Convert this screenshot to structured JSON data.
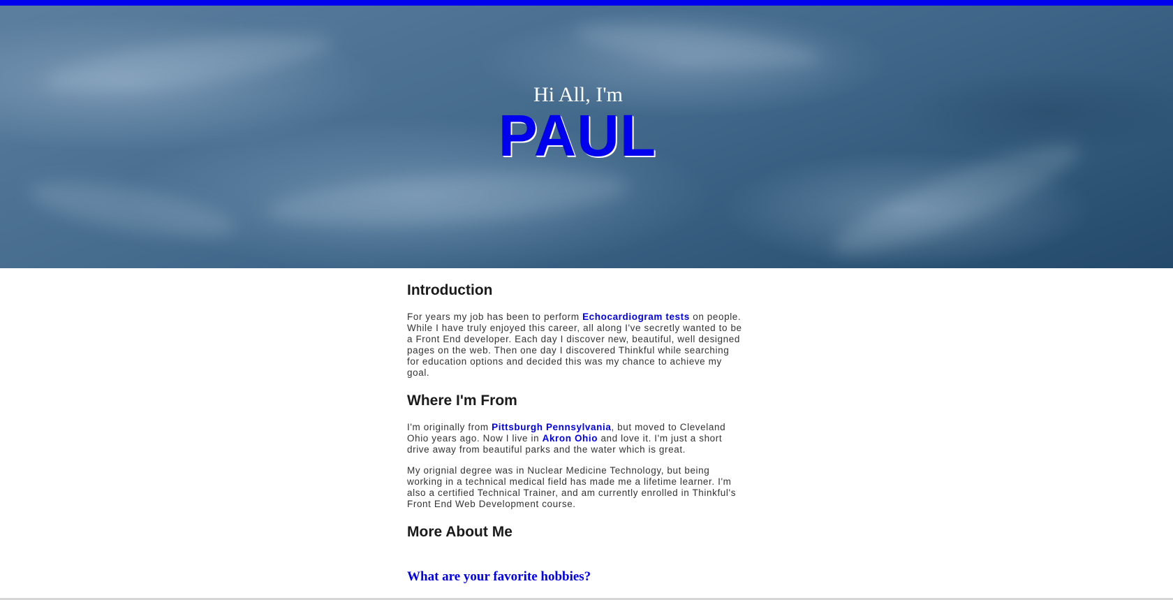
{
  "hero": {
    "greeting": "Hi All, I'm",
    "name": "PAUL"
  },
  "colors": {
    "accent": "#0000ee",
    "heading": "#1a1a1a",
    "body_text": "#333333"
  },
  "intro": {
    "heading": "Introduction",
    "p1_before": "For years my job has been to perform ",
    "p1_link": "Echocardiogram tests",
    "p1_after": " on people. While I have truly enjoyed this career, all along I've secretly wanted to be a Front End developer. Each day I discover new, beautiful, well designed pages on the web. Then one day I discovered Thinkful while searching for education options and decided this was my chance to achieve my goal."
  },
  "from": {
    "heading": "Where I'm From",
    "p1_before": "I'm originally from ",
    "p1_link1": "Pittsburgh Pennsylvania",
    "p1_middle": ", but moved to Cleveland Ohio years ago. Now I live in ",
    "p1_link2": "Akron Ohio",
    "p1_after": " and love it. I'm just a short drive away from beautiful parks and the water which is great.",
    "p2": "My orignial degree was in Nuclear Medicine Technology, but being working in a technical medical field has made me a lifetime learner. I'm also a certified Technical Trainer, and am currently enrolled in Thinkful's Front End Web Development course."
  },
  "more": {
    "heading": "More About Me",
    "hobbies_question": "What are your favorite hobbies?"
  }
}
